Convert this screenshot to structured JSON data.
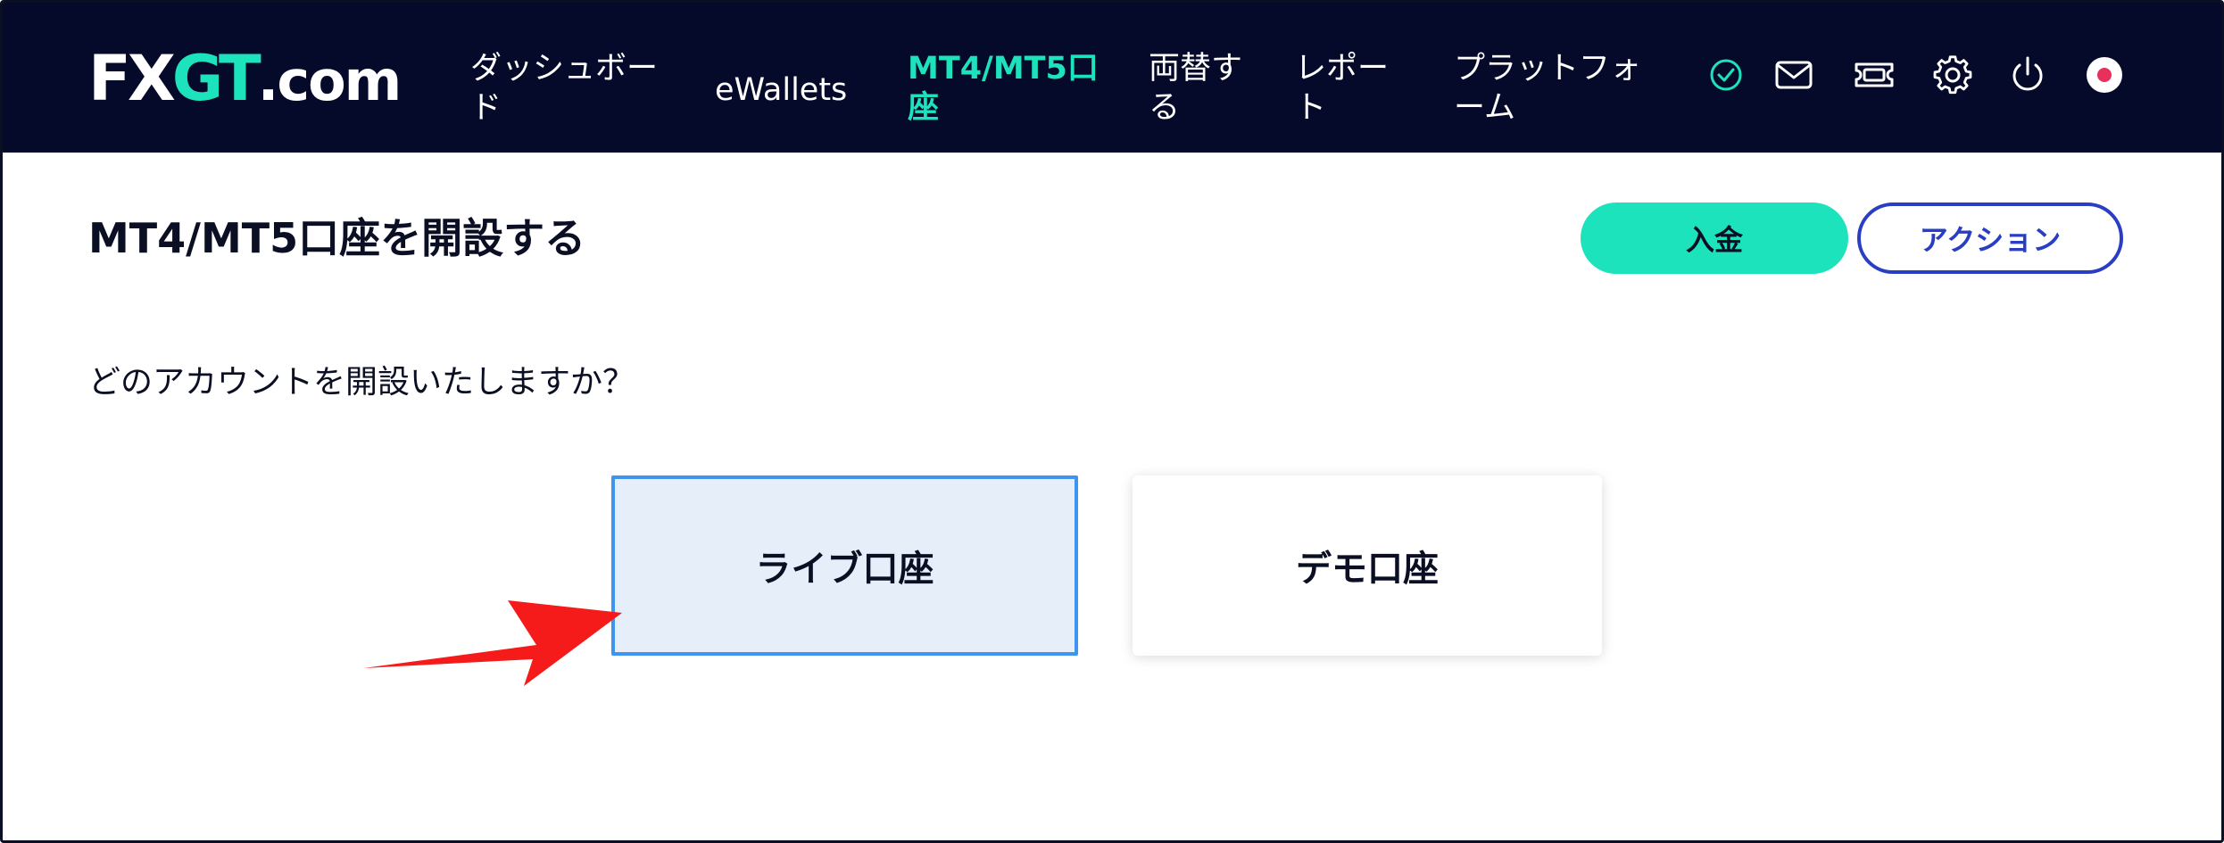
{
  "header": {
    "logo": {
      "part1": "FX",
      "part2": "GT",
      "part3": ".com"
    },
    "nav": [
      {
        "label": "ダッシュボー\nド"
      },
      {
        "label": "eWallets"
      },
      {
        "label": "MT4/MT5口\n座"
      },
      {
        "label": "両替す\nる"
      },
      {
        "label": "レポー\nト"
      },
      {
        "label": "プラットフォ\nーム"
      }
    ],
    "icons": [
      "verified-check-icon",
      "mail-icon",
      "ticket-icon",
      "gear-icon",
      "power-icon",
      "japan-flag-icon"
    ],
    "colors": {
      "background": "#050a2a",
      "accent": "#1de3bd"
    }
  },
  "main": {
    "title": "MT4/MT5口座を開設する",
    "deposit_label": "入金",
    "action_label": "アクション",
    "question": "どのアカウントを開設いたしますか？",
    "cards": [
      {
        "label": "ライブ口座",
        "selected": true
      },
      {
        "label": "デモ口座",
        "selected": false
      }
    ],
    "colors": {
      "action_border": "#2a3ec4",
      "selected_border": "#3e94ef",
      "annotation_arrow": "#f51b1b"
    }
  }
}
